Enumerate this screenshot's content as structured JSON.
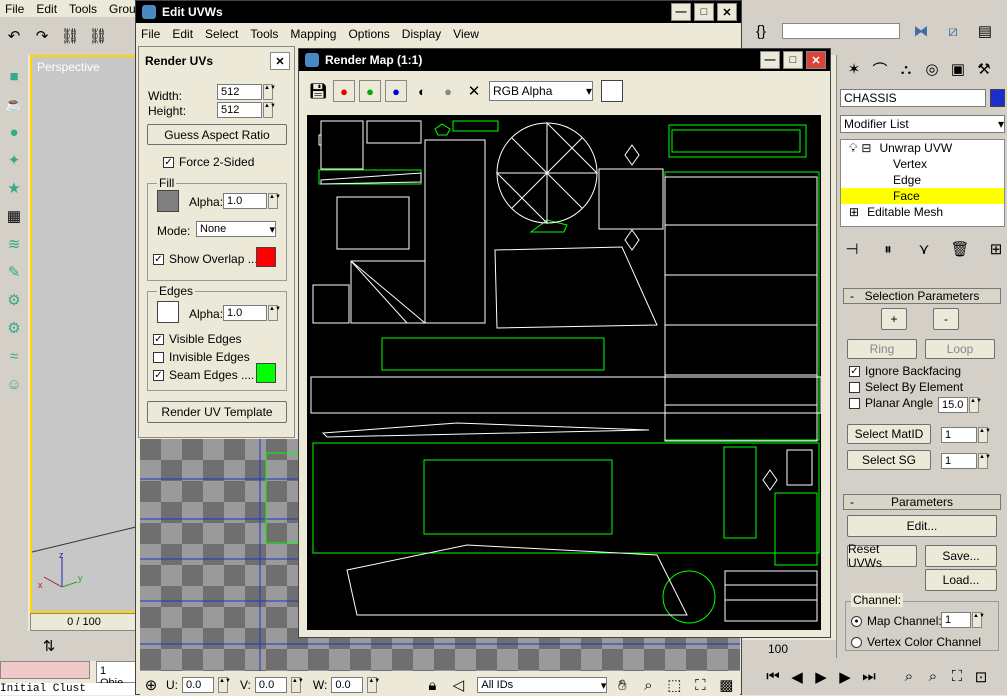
{
  "main_menu": [
    "File",
    "Edit",
    "Tools",
    "Group"
  ],
  "viewport": {
    "label": "Perspective",
    "frame_counter": "0 / 100",
    "status_field": "1 Obje",
    "script_text": "Initial Clust",
    "axis_z": "z",
    "axis_y": "y",
    "axis_x": "x"
  },
  "edit_uvws": {
    "title": "Edit UVWs",
    "menu": [
      "File",
      "Edit",
      "Select",
      "Tools",
      "Mapping",
      "Options",
      "Display",
      "View"
    ],
    "u_label": "U:",
    "u_value": "0.0",
    "v_label": "V:",
    "v_value": "0.0",
    "w_label": "W:",
    "w_value": "0.0",
    "ids_dropdown": "All IDs"
  },
  "render_uvs": {
    "title": "Render UVs",
    "width_label": "Width:",
    "width_value": "512",
    "height_label": "Height:",
    "height_value": "512",
    "guess_aspect": "Guess Aspect Ratio",
    "force2sided": "Force 2-Sided",
    "fill_group": "Fill",
    "fill_alpha_label": "Alpha:",
    "fill_alpha": "1.0",
    "mode_label": "Mode:",
    "mode_value": "None",
    "show_overlap": "Show Overlap ...",
    "edges_group": "Edges",
    "edges_alpha_label": "Alpha:",
    "edges_alpha": "1.0",
    "visible_edges": "Visible Edges",
    "invisible_edges": "Invisible Edges",
    "seam_edges": "Seam Edges ....",
    "render_template": "Render UV Template",
    "colors": {
      "fill": "#808080",
      "overlap": "#ff0000",
      "edges": "#ffffff",
      "seam": "#00ff00"
    }
  },
  "render_map": {
    "title": "Render Map (1:1)",
    "channel_dropdown": "RGB Alpha"
  },
  "command_panel": {
    "object_name": "CHASSIS",
    "modifier_list": "Modifier List",
    "stack": [
      "Unwrap UVW",
      "Vertex",
      "Edge",
      "Face",
      "Editable Mesh"
    ],
    "selection_params": "Selection Parameters",
    "plus": "+",
    "minus": "-",
    "ring": "Ring",
    "loop": "Loop",
    "ignore_backfacing": "Ignore Backfacing",
    "select_by_element": "Select By Element",
    "planar_angle": "Planar Angle",
    "planar_value": "15.0",
    "select_matid": "Select MatID",
    "matid_value": "1",
    "select_sg": "Select SG",
    "sg_value": "1",
    "parameters": "Parameters",
    "edit": "Edit...",
    "reset_uvws": "Reset UVWs",
    "save": "Save...",
    "load": "Load...",
    "channel_label": "Channel:",
    "map_channel": "Map Channel:",
    "map_channel_value": "1",
    "vertex_color_channel": "Vertex Color Channel",
    "timeline_value": "100"
  }
}
